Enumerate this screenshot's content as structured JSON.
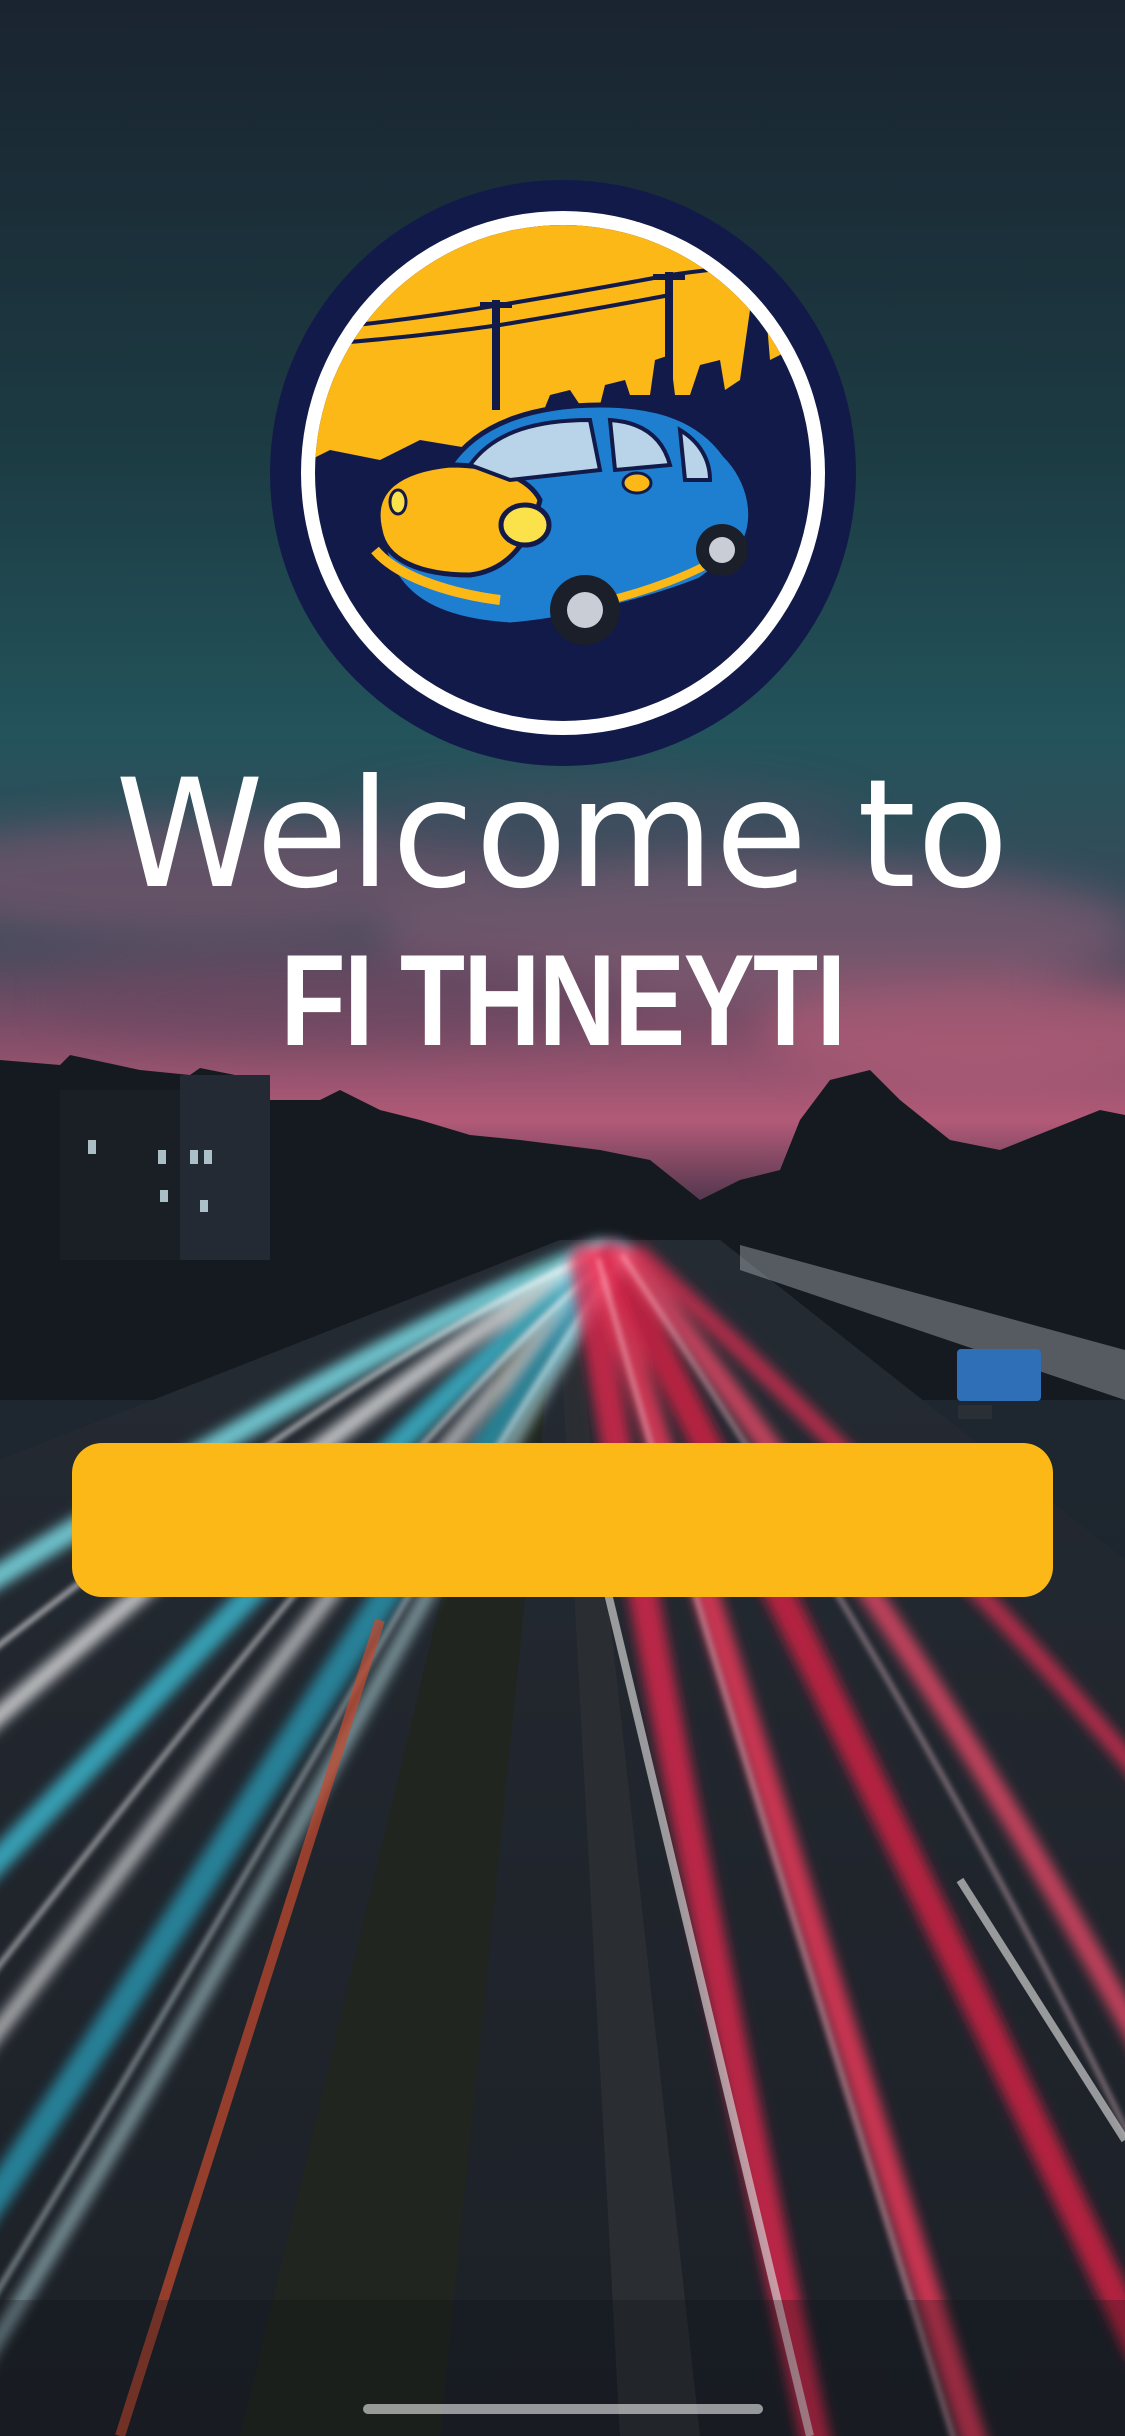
{
  "welcome": {
    "line1": "Welcome to",
    "line2": "FI THNEYTI"
  },
  "cta": {
    "label": ""
  },
  "colors": {
    "accent": "#fbb816",
    "logo_navy": "#121a4a",
    "car_blue": "#1e7fd0",
    "text": "#ffffff"
  },
  "icons": {
    "logo": "car-city-logo-icon"
  }
}
